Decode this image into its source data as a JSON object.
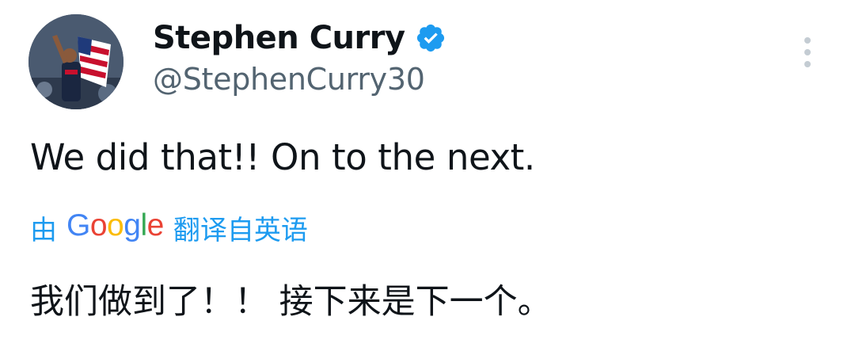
{
  "author": {
    "display_name": "Stephen Curry",
    "handle": "@StephenCurry30",
    "verified": true
  },
  "tweet": {
    "text": "We did that!! On to the next."
  },
  "translation": {
    "prefix": "由",
    "provider_letters": [
      "G",
      "o",
      "o",
      "g",
      "l",
      "e"
    ],
    "suffix": "翻译自英语",
    "translated_text": "我们做到了！！ 接下来是下一个。"
  },
  "colors": {
    "link": "#1d9bf0",
    "verified": "#1d9bf0",
    "handle": "#536471",
    "text": "#0f1419"
  },
  "icons": {
    "verified": "verified-badge-icon",
    "more": "more-vertical-icon"
  }
}
